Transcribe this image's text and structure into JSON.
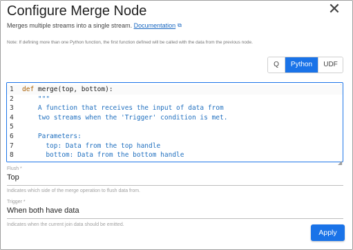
{
  "dialog": {
    "title": "Configure Merge Node",
    "close_icon": "close-icon",
    "description": "Merges multiple streams into a single stream.",
    "doc_link": "Documentation",
    "doc_link_icon": "external-link-icon",
    "note": "Note: If defining more than one Python function, the first function defined will be called with the data from the previous node."
  },
  "mode_toggle": {
    "options": [
      "Q",
      "Python",
      "UDF"
    ],
    "selected": "Python",
    "selected_color": "#1a73e8"
  },
  "editor": {
    "lines": [
      {
        "num": "1",
        "parts": [
          {
            "t": "kw",
            "v": "def"
          },
          {
            "t": "plain",
            "v": " merge(top, bottom):"
          }
        ]
      },
      {
        "num": "2",
        "parts": [
          {
            "t": "str",
            "v": "    \"\"\""
          }
        ]
      },
      {
        "num": "3",
        "parts": [
          {
            "t": "str",
            "v": "    A function that receives the input of data from"
          }
        ]
      },
      {
        "num": "4",
        "parts": [
          {
            "t": "str",
            "v": "    two streams when the 'Trigger' condition is met."
          }
        ]
      },
      {
        "num": "5",
        "parts": [
          {
            "t": "str",
            "v": ""
          }
        ]
      },
      {
        "num": "6",
        "parts": [
          {
            "t": "str",
            "v": "    Parameters:"
          }
        ]
      },
      {
        "num": "7",
        "parts": [
          {
            "t": "str",
            "v": "      top: Data from the top handle"
          }
        ]
      },
      {
        "num": "8",
        "parts": [
          {
            "t": "str",
            "v": "      bottom: Data from the bottom handle"
          }
        ]
      }
    ],
    "resize_icon": "resize-handle-icon"
  },
  "flush": {
    "label": "Flush *",
    "value": "Top",
    "help": "Indicates which side of the merge operation to flush data from."
  },
  "trigger": {
    "label": "Trigger *",
    "value": "When both have data",
    "help": "Indicates when the current join data should be emitted."
  },
  "actions": {
    "apply_label": "Apply",
    "accent_color": "#1a73e8"
  }
}
